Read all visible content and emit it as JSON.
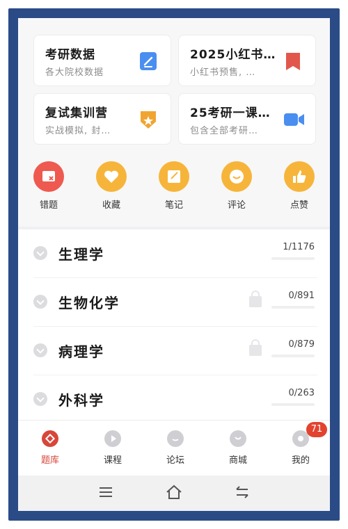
{
  "cards": [
    {
      "title": "考研数据",
      "subtitle": "各大院校数据",
      "icon": "document-edit-icon",
      "color": "#3b82f6"
    },
    {
      "title": "2025小红书…",
      "subtitle": "小红书预售, …",
      "icon": "bookmark-icon",
      "color": "#e2574c"
    },
    {
      "title": "复试集训营",
      "subtitle": "实战模拟, 封…",
      "icon": "badge-star-icon",
      "color": "#f0a531"
    },
    {
      "title": "25考研一课…",
      "subtitle": "包含全部考研…",
      "icon": "video-camera-icon",
      "color": "#3b82f6"
    }
  ],
  "quick_actions": [
    {
      "label": "错题",
      "icon": "wrong-questions-icon",
      "color": "#ee5a50"
    },
    {
      "label": "收藏",
      "icon": "heart-icon",
      "color": "#f6b53a"
    },
    {
      "label": "笔记",
      "icon": "note-icon",
      "color": "#f6b53a"
    },
    {
      "label": "评论",
      "icon": "comment-icon",
      "color": "#f6b53a"
    },
    {
      "label": "点赞",
      "icon": "thumbs-up-icon",
      "color": "#f6b53a"
    }
  ],
  "subjects": [
    {
      "title": "生理学",
      "count": "1/1176",
      "locked": false
    },
    {
      "title": "生物化学",
      "count": "0/891",
      "locked": true
    },
    {
      "title": "病理学",
      "count": "0/879",
      "locked": true
    },
    {
      "title": "外科学",
      "count": "0/263",
      "locked": false
    }
  ],
  "tabs": [
    {
      "label": "题库",
      "icon": "question-bank-icon",
      "active": true
    },
    {
      "label": "课程",
      "icon": "play-icon",
      "active": false
    },
    {
      "label": "论坛",
      "icon": "forum-icon",
      "active": false
    },
    {
      "label": "商城",
      "icon": "shop-icon",
      "active": false
    },
    {
      "label": "我的",
      "icon": "profile-icon",
      "active": false,
      "badge": "71"
    }
  ],
  "navbar": {
    "icons": [
      "menu-icon",
      "home-icon",
      "back-icon"
    ]
  },
  "colors": {
    "accent": "#d8463a",
    "frame": "#2a4b86"
  }
}
